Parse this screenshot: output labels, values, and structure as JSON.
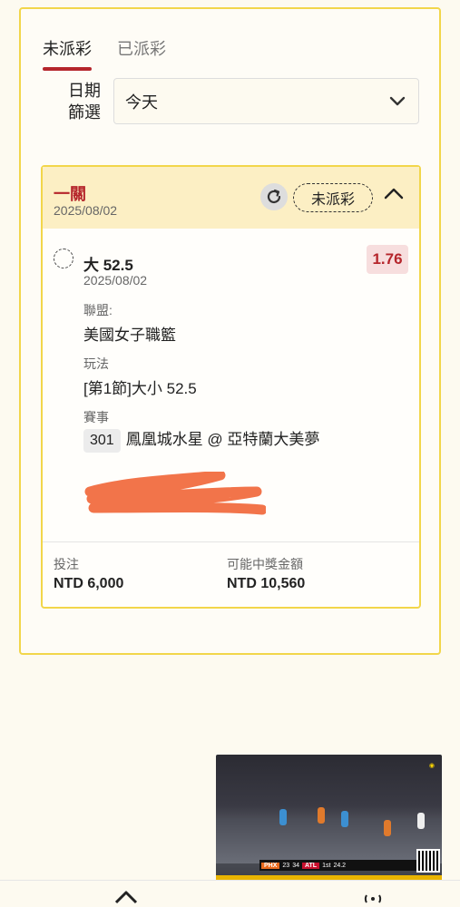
{
  "tabs": [
    {
      "label": "未派彩",
      "active": true
    },
    {
      "label": "已派彩",
      "active": false
    }
  ],
  "filter": {
    "label_line1": "日期",
    "label_line2": "篩選",
    "selected": "今天"
  },
  "bet_card": {
    "title": "一關",
    "date": "2025/08/02",
    "status": "未派彩",
    "selection": {
      "name": "大 52.5",
      "date": "2025/08/02",
      "odds": "1.76"
    },
    "league_label": "聯盟:",
    "league": "美國女子職籃",
    "market_label": "玩法",
    "market": "[第1節]大小 52.5",
    "event_label": "賽事",
    "event_code": "301",
    "event": "鳳凰城水星 @ 亞特蘭大美夢",
    "stake_label": "投注",
    "stake": "NTD 6,000",
    "payout_label": "可能中獎金額",
    "payout": "NTD 10,560"
  },
  "video_overlay": {
    "team_home": "PHX",
    "score_home": "23",
    "score_away": "34",
    "team_away": "ATL",
    "period": "1st",
    "clock": "24.2"
  },
  "colors": {
    "accent_red": "#b5252b",
    "border_yellow": "#f2d64a",
    "header_yellow": "#fcefc4",
    "odds_bg": "#f7dede"
  },
  "icons": {
    "dropdown": "chevron-down-icon",
    "refresh": "refresh-icon",
    "collapse": "chevron-up-icon",
    "selection": "radio-dashed-icon"
  }
}
